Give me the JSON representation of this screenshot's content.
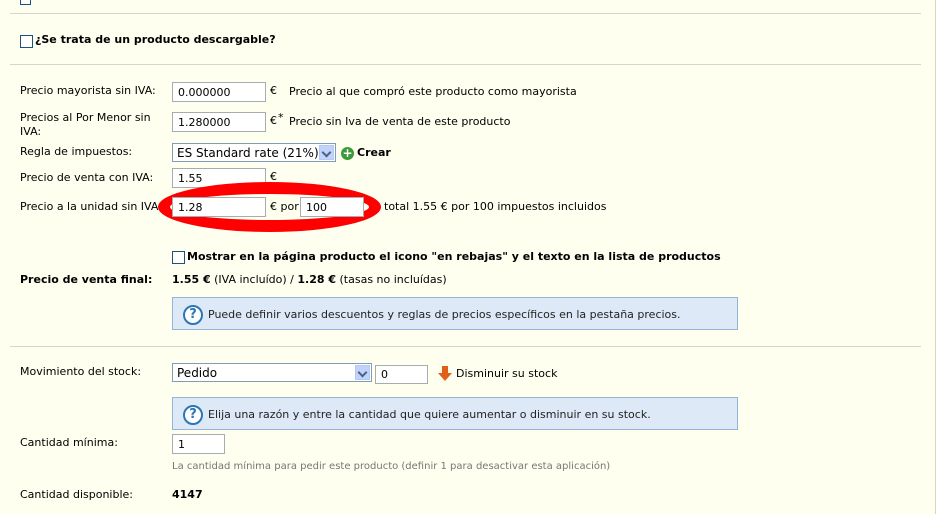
{
  "download_question": "¿Se trata de un producto descargable?",
  "wholesale": {
    "label": "Precio mayorista sin IVA:",
    "value": "0.000000",
    "currency": "€",
    "help": "Precio al que compró este producto como mayorista"
  },
  "retail": {
    "label_line1": "Precios al Por Menor sin",
    "label_line2": "IVA:",
    "value": "1.280000",
    "currency": "€",
    "required_mark": "*",
    "help": "Precio sin Iva de venta de este producto"
  },
  "tax_rule": {
    "label": "Regla de impuestos:",
    "selected": "ES Standard rate (21%)",
    "create_label": "Crear"
  },
  "sale_price": {
    "label": "Precio de venta con IVA:",
    "value": "1.55",
    "currency": "€"
  },
  "unit_price": {
    "label": "Precio a la unidad sin IVA",
    "value": "1.28",
    "currency_por": "€ por",
    "qty": "100",
    "summary": "total 1.55 € por 100 impuestos incluidos"
  },
  "on_sale": {
    "label": "Mostrar en la página producto el icono \"en rebajas\" y el texto en la lista de productos"
  },
  "final_price": {
    "label": "Precio de venta final:",
    "incl_value": "1.55 €",
    "incl_text": " (IVA incluído) / ",
    "excl_value": "1.28 €",
    "excl_text": " (tasas no incluídas)"
  },
  "hint_prices": "Puede definir varios descuentos y reglas de precios específicos en la pestaña precios.",
  "stock_movement": {
    "label": "Movimiento del stock:",
    "selected": "Pedido",
    "qty": "0",
    "action_label": "Disminuir su stock"
  },
  "hint_stock": "Elija una razón y entre la cantidad que quiere aumentar o disminuir en su stock.",
  "min_qty": {
    "label": "Cantidad mínima:",
    "value": "1",
    "help": "La cantidad mínima para pedir este producto (definir 1 para desactivar esta aplicación)"
  },
  "available_qty": {
    "label": "Cantidad disponible:",
    "value": "4147"
  },
  "colors": {
    "background": "#fffff0",
    "annotation": "#ff0000",
    "hint_bg": "#dde9f7",
    "create_icon": "#3a9a3a",
    "arrow_icon": "#e0601a"
  }
}
